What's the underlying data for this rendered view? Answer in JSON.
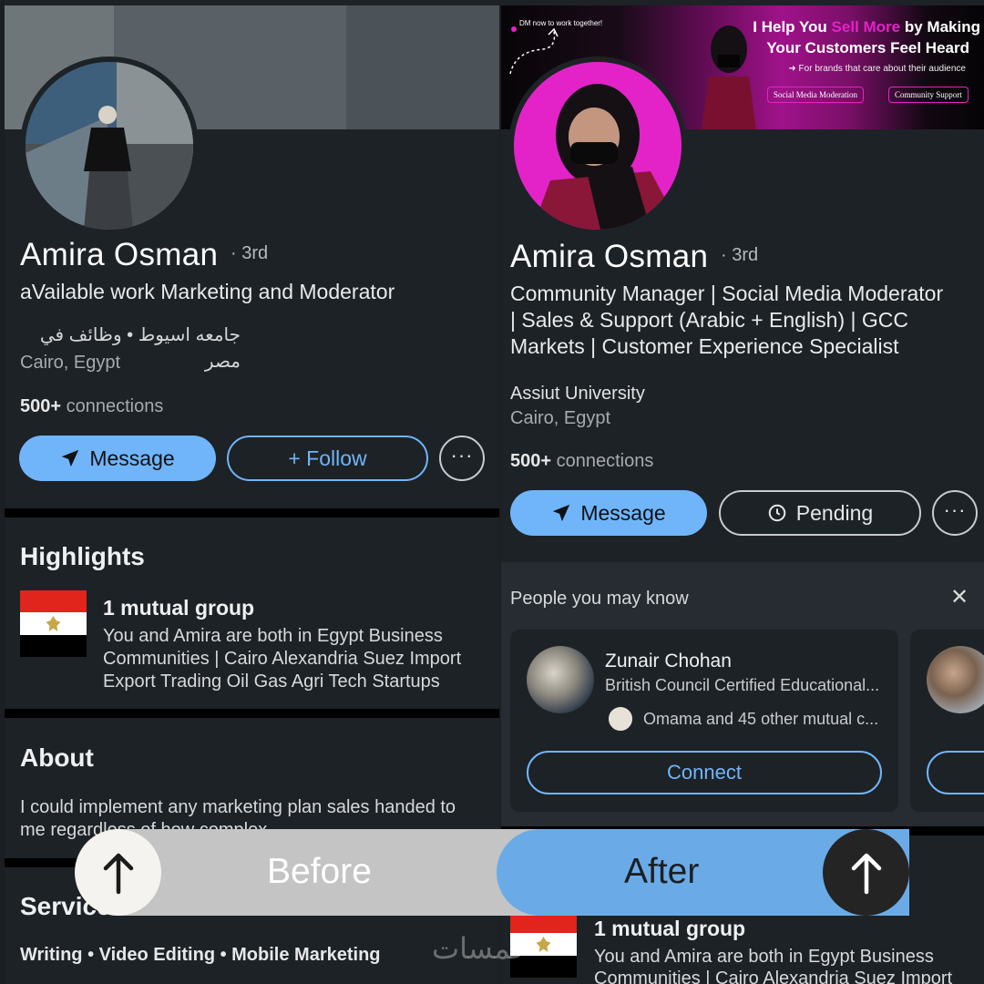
{
  "before": {
    "name": "Amira Osman",
    "degree": "· 3rd",
    "headline": "aVailable work Marketing and Moderator",
    "education_line": "جامعه اسيوط • وظائف في مصر",
    "location": "Cairo, Egypt",
    "connections_count": "500+",
    "connections_label": "connections",
    "message_label": "Message",
    "follow_label": "+ Follow",
    "more_label": "···",
    "highlights_title": "Highlights",
    "mutual_group_title": "1 mutual group",
    "mutual_group_text_1": "You and Amira are both in Egypt Business",
    "mutual_group_text_2": "Communities | Cairo Alexandria Suez Import",
    "mutual_group_text_3": "Export Trading Oil Gas Agri Tech Startups",
    "about_title": "About",
    "about_text_1": "I could implement any marketing plan sales handed to",
    "about_text_2": "me regardless of how complex",
    "services_title": "Services",
    "services_text": "Writing • Video Editing • Mobile Marketing"
  },
  "after": {
    "banner_dm": "DM now to work together!",
    "banner_heading_1a": "I Help You ",
    "banner_heading_1b": "Sell More",
    "banner_heading_1c": " by Making",
    "banner_heading_2": "Your Customers Feel Heard",
    "banner_sub": "➜ For brands that care about their audience",
    "banner_tag_1": "Social Media Moderation",
    "banner_tag_2": "Community Support",
    "name": "Amira Osman",
    "degree": "· 3rd",
    "headline_1": "Community Manager | Social Media Moderator",
    "headline_2": "| Sales & Support (Arabic + English) | GCC",
    "headline_3": "Markets | Customer Experience Specialist",
    "education": "Assiut University",
    "location": "Cairo, Egypt",
    "connections_count": "500+",
    "connections_label": "connections",
    "message_label": "Message",
    "pending_label": "Pending",
    "more_label": "···",
    "pymk_title": "People you may know",
    "pymk_close": "✕",
    "person_name": "Zunair Chohan",
    "person_headline": "British Council Certified Educational...",
    "person_mutual": "Omama and 45 other mutual c...",
    "connect_label": "Connect",
    "mutual_group_title": "1 mutual group",
    "mutual_group_text_1": "You and Amira are both in Egypt Business",
    "mutual_group_text_2": "Communities | Cairo Alexandria Suez Import"
  },
  "overlay": {
    "before_label": "Before",
    "after_label": "After"
  },
  "watermark": "خمسات",
  "colors": {
    "accent_blue": "#70b5f9",
    "background": "#1d2226",
    "banner_magenta": "#a0128a",
    "before_bar": "#c4c4c4",
    "after_bar": "#6aabe7"
  }
}
